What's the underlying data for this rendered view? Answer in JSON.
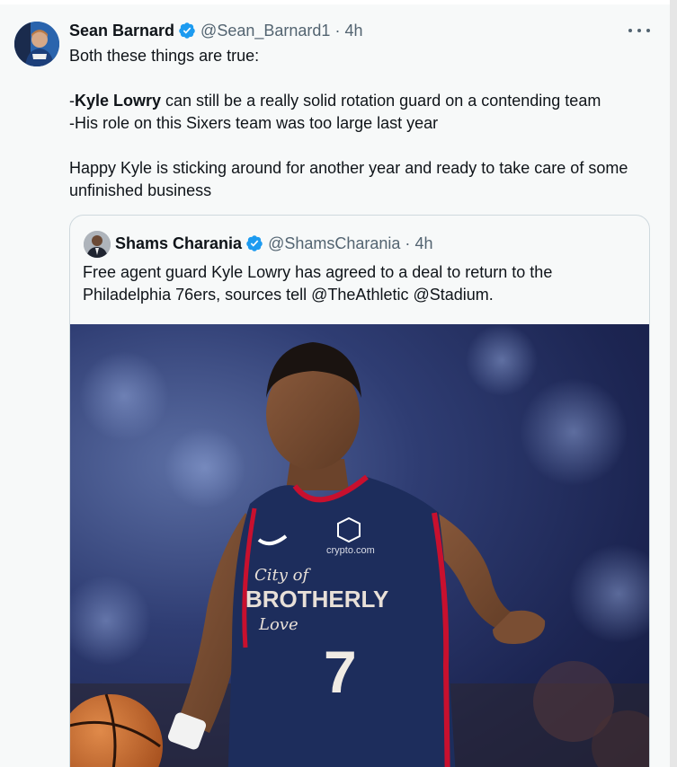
{
  "tweet": {
    "author_name": "Sean Barnard",
    "handle": "@Sean_Barnard1",
    "separator": "·",
    "time": "4h",
    "line_prefix": "-",
    "mention_bold": "Kyle Lowry",
    "line1_rest": " can still be a really solid rotation guard on a contending team",
    "intro": "Both these things are true:",
    "line2": "-His role on this Sixers team was too large last year",
    "line3": "Happy Kyle is sticking around for another year and ready to take care of some unfinished business"
  },
  "quoted": {
    "author_name": "Shams Charania",
    "handle": "@ShamsCharania",
    "separator": "·",
    "time": "4h",
    "text": "Free agent guard Kyle Lowry has agreed to a deal to return to the Philadelphia 76ers, sources tell @TheAthletic @Stadium."
  },
  "jersey": {
    "sponsor": "crypto.com",
    "city_line1": "City of",
    "city_line2": "BROTHERLY",
    "city_line3": "Love",
    "number": "7"
  },
  "colors": {
    "verified": "#1d9bf0",
    "text_primary": "#0f1419",
    "text_secondary": "#536471",
    "jersey_navy": "#1d2d5c",
    "jersey_red": "#c8102e"
  },
  "icons": {
    "verified": "verified-badge-icon",
    "more": "more-options-icon"
  }
}
